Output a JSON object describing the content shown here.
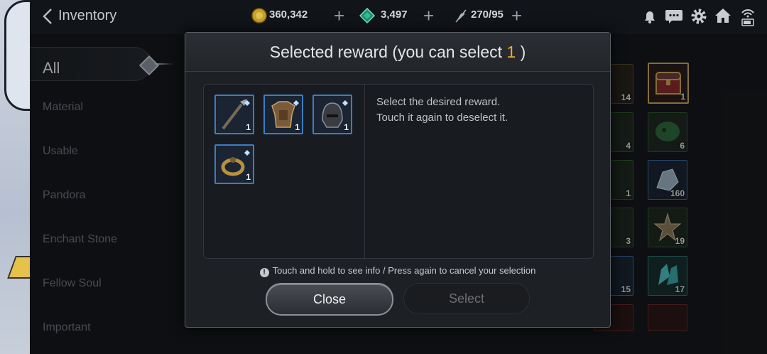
{
  "header": {
    "title": "Inventory",
    "gold": "360,342",
    "gems": "3,497",
    "stamina": "270/95"
  },
  "sidebar": {
    "items": [
      {
        "label": "All"
      },
      {
        "label": "Material"
      },
      {
        "label": "Usable"
      },
      {
        "label": "Pandora"
      },
      {
        "label": "Enchant Stone"
      },
      {
        "label": "Fellow Soul"
      },
      {
        "label": "Important"
      }
    ]
  },
  "grid_counts": [
    "14",
    "1",
    "4",
    "6",
    "1",
    "160",
    "3",
    "19",
    "15",
    "17"
  ],
  "modal": {
    "title_prefix": "Selected reward (you can select ",
    "count": "1",
    "title_suffix": " )",
    "desc_line1": "Select the desired reward.",
    "desc_line2": "Touch it again to deselect it.",
    "rewards": [
      {
        "icon": "spear-weapon-icon",
        "qty": "1"
      },
      {
        "icon": "armor-icon",
        "qty": "1"
      },
      {
        "icon": "helmet-icon",
        "qty": "1"
      },
      {
        "icon": "ring-icon",
        "qty": "1"
      }
    ],
    "hint": "Touch and hold to see info / Press again to cancel your selection",
    "close_label": "Close",
    "select_label": "Select"
  },
  "colors": {
    "accent_count": "#f0a830",
    "tile_border": "#3b7dc4"
  }
}
